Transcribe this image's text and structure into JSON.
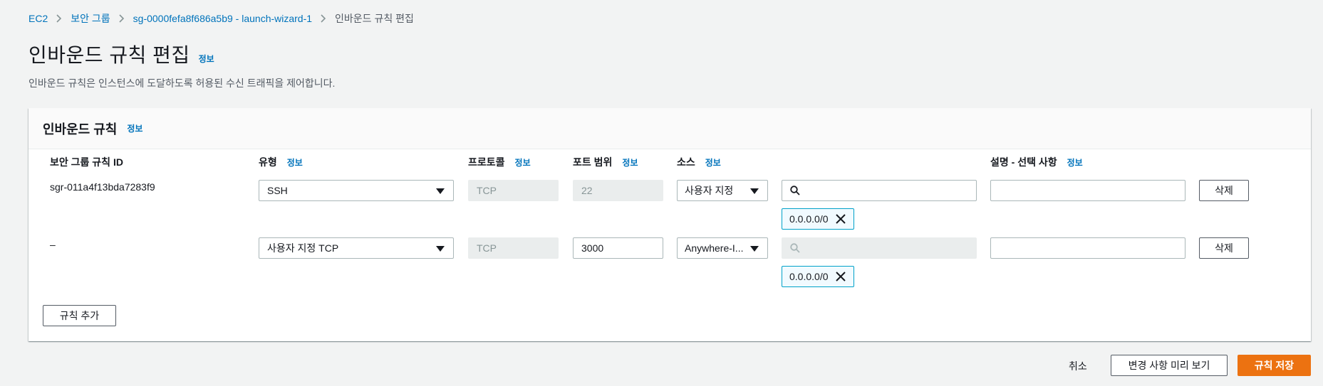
{
  "breadcrumb": {
    "items": [
      "EC2",
      "보안 그룹",
      "sg-0000fefa8f686a5b9 - launch-wizard-1"
    ],
    "current": "인바운드 규칙 편집"
  },
  "page": {
    "title": "인바운드 규칙 편집",
    "info": "정보",
    "description": "인바운드 규칙은 인스턴스에 도달하도록 허용된 수신 트래픽을 제어합니다."
  },
  "panel": {
    "title": "인바운드 규칙",
    "info": "정보",
    "columns": {
      "rule_id": "보안 그룹 규칙 ID",
      "type": "유형",
      "protocol": "프로토콜",
      "port": "포트 범위",
      "source": "소스",
      "description": "설명 - 선택 사항"
    },
    "info_label": "정보",
    "rows": [
      {
        "rule_id": "sgr-011a4f13bda7283f9",
        "type": "SSH",
        "protocol": "TCP",
        "port": "22",
        "source": "사용자 지정",
        "search_value": "",
        "token": "0.0.0.0/0",
        "description": "",
        "delete": "삭제"
      },
      {
        "rule_id": "–",
        "type": "사용자 지정 TCP",
        "protocol": "TCP",
        "port": "3000",
        "source": "Anywhere-I...",
        "search_value": "",
        "token": "0.0.0.0/0",
        "description": "",
        "delete": "삭제"
      }
    ],
    "add_rule": "규칙 추가"
  },
  "footer": {
    "cancel": "취소",
    "preview": "변경 사항 미리 보기",
    "save": "규칙 저장"
  },
  "colors": {
    "link": "#0073bb",
    "primary": "#ec7211",
    "token_border": "#00a1c9",
    "background": "#f2f3f3"
  }
}
